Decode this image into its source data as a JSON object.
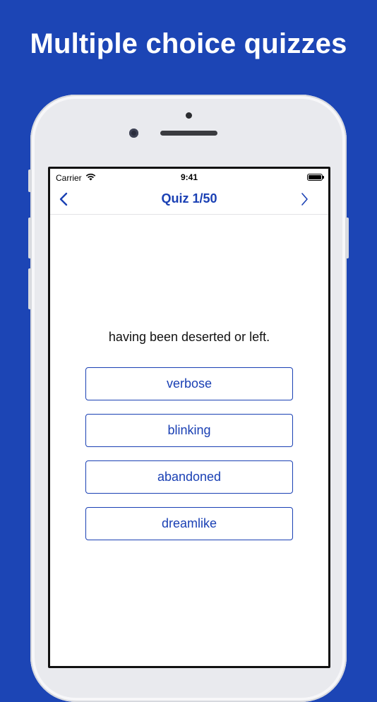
{
  "headline": "Multiple choice quizzes",
  "colors": {
    "background": "#1c45b5",
    "accent": "#1a40b4"
  },
  "status_bar": {
    "carrier": "Carrier",
    "time": "9:41",
    "wifi_icon": "wifi-icon",
    "battery_icon": "battery-icon"
  },
  "nav": {
    "title": "Quiz 1/50",
    "back_icon": "chevron-left-icon",
    "forward_icon": "chevron-right-icon"
  },
  "quiz": {
    "question": "having been deserted or left.",
    "answers": [
      "verbose",
      "blinking",
      "abandoned",
      "dreamlike"
    ]
  }
}
